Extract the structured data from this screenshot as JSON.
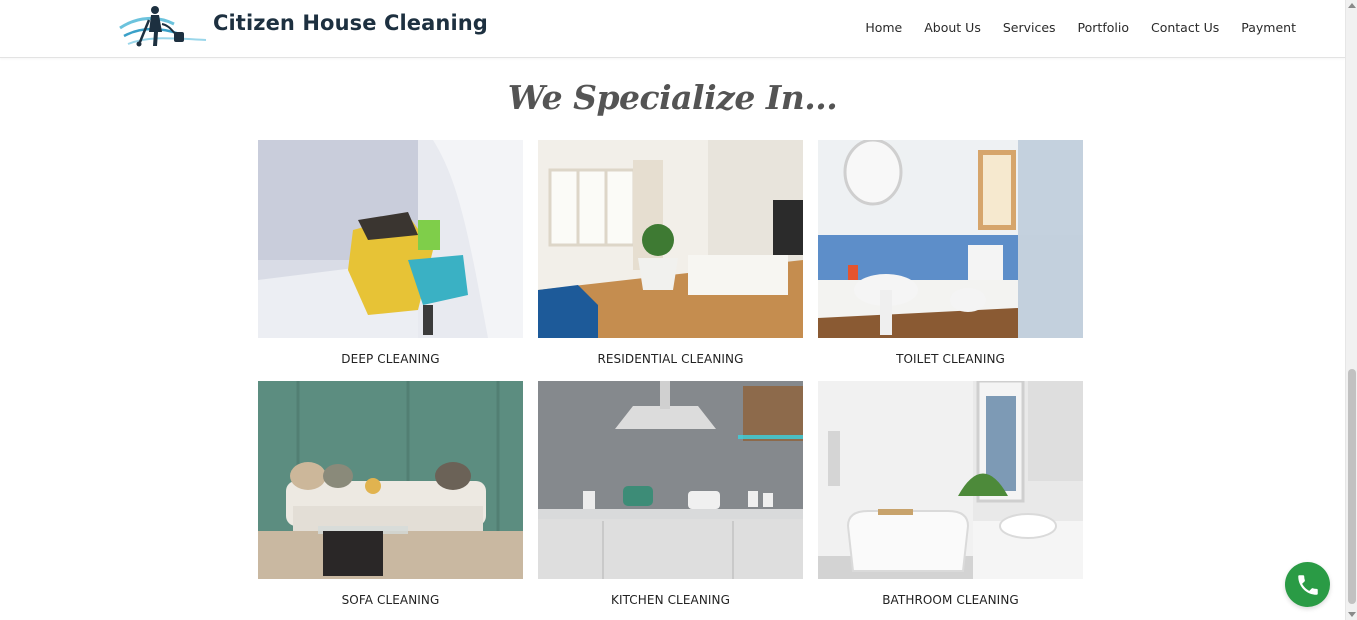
{
  "header": {
    "brand": "Citizen House Cleaning",
    "nav": [
      "Home",
      "About Us",
      "Services",
      "Portfolio",
      "Contact Us",
      "Payment"
    ]
  },
  "section": {
    "title": "We Specialize In..."
  },
  "services": [
    {
      "label": "DEEP CLEANING",
      "image": "gloved-hand-spraying-cloth"
    },
    {
      "label": "RESIDENTIAL CLEANING",
      "image": "bright-living-room"
    },
    {
      "label": "TOILET CLEANING",
      "image": "blue-bathroom-toilet"
    },
    {
      "label": "SOFA CLEANING",
      "image": "sofa-green-wall"
    },
    {
      "label": "KITCHEN CLEANING",
      "image": "grey-kitchen"
    },
    {
      "label": "BATHROOM CLEANING",
      "image": "white-bathtub"
    }
  ],
  "call_button": {
    "icon": "phone-icon",
    "color": "#2a9b45"
  },
  "colors": {
    "brand": "#1d3040",
    "accent": "#3aa0c8",
    "call": "#2a9b45"
  }
}
